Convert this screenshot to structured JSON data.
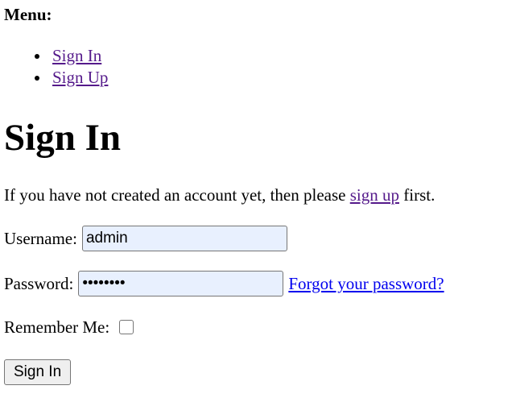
{
  "menu": {
    "title": "Menu:",
    "items": [
      {
        "label": "Sign In"
      },
      {
        "label": "Sign Up"
      }
    ]
  },
  "page": {
    "title": "Sign In",
    "intro_prefix": "If you have not created an account yet, then please ",
    "intro_link": "sign up",
    "intro_suffix": " first."
  },
  "form": {
    "username_label": "Username:",
    "username_value": "admin",
    "password_label": "Password:",
    "password_value": "password",
    "forgot_link": "Forgot your password?",
    "remember_label": "Remember Me:",
    "remember_checked": false,
    "submit_label": "Sign In"
  },
  "colors": {
    "visited_link": "#551a8b",
    "unvisited_link": "#0000ee",
    "autofill_bg": "#e8f0fe"
  }
}
